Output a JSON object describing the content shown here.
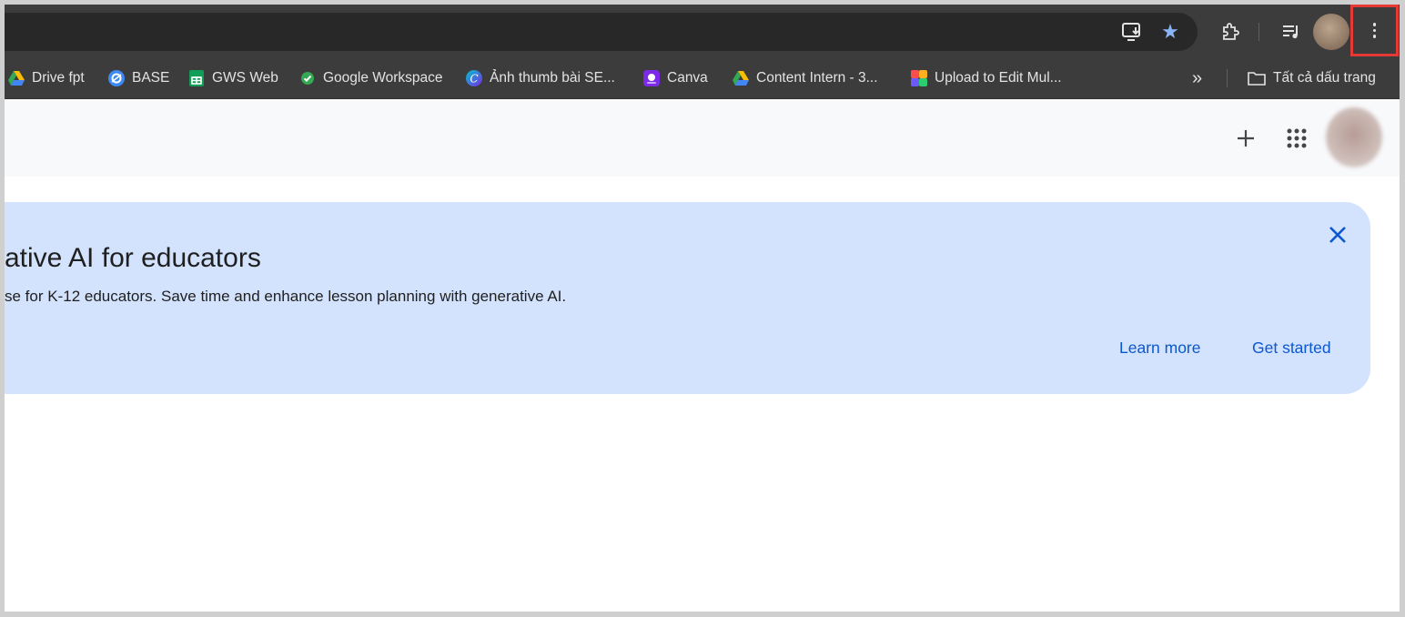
{
  "bookmarks": [
    {
      "label": "Drive fpt",
      "icon": "google-drive-icon"
    },
    {
      "label": "BASE",
      "icon": "base-icon"
    },
    {
      "label": "GWS Web",
      "icon": "google-sheets-icon"
    },
    {
      "label": "Google Workspace",
      "icon": "green-check-icon"
    },
    {
      "label": "Ảnh thumb bài SE...",
      "icon": "canva-c-icon"
    },
    {
      "label": "Canva",
      "icon": "canva-icon"
    },
    {
      "label": "Content Intern - 3...",
      "icon": "google-drive-icon"
    },
    {
      "label": "Upload to Edit Mul...",
      "icon": "colorful-grid-icon"
    }
  ],
  "bookmarks_overflow": "»",
  "all_bookmarks_label": "Tất cả dấu trang",
  "banner": {
    "title": "ative AI for educators",
    "description": "se for K-12 educators. Save time and enhance lesson planning with generative AI.",
    "learn_more": "Learn more",
    "get_started": "Get started"
  },
  "colors": {
    "accent": "#0b57d0",
    "banner_bg": "#d3e3fd",
    "highlight": "#e53935",
    "toolbar": "#3c3c3c",
    "star": "#8ab4f8"
  }
}
